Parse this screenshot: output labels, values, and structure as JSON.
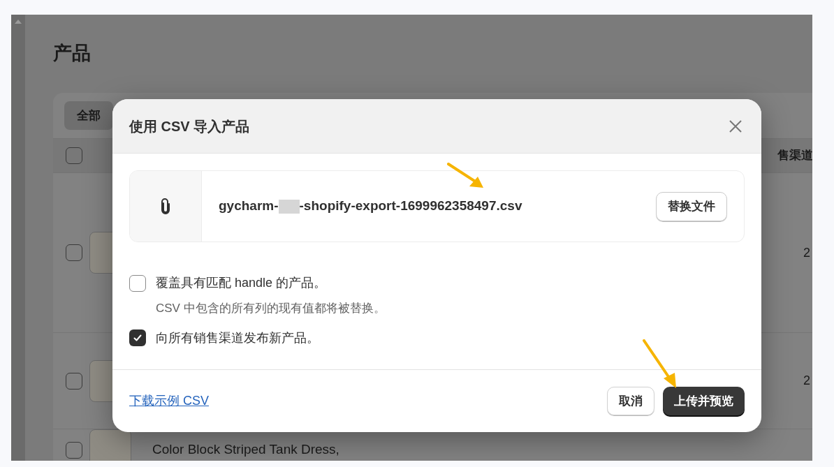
{
  "background_page": {
    "title": "产品",
    "tabs": [
      {
        "label": "全部",
        "selected": true
      }
    ],
    "table": {
      "header": {
        "checked": false,
        "column_label": "售渠道"
      },
      "rows": [
        {
          "checked": false,
          "kind": "thumbnail",
          "value": "2"
        },
        {
          "checked": false,
          "kind": "thumbnail",
          "value": "2"
        },
        {
          "checked": false,
          "kind": "thumbnail",
          "product": "Color Block Striped Tank Dress,"
        }
      ]
    }
  },
  "dialog": {
    "title": "使用 CSV 导入产品",
    "file": {
      "name_start": "gycharm-",
      "name_end": "-shopify-export-1699962358497.csv",
      "replace_button": "替换文件"
    },
    "options": [
      {
        "label": "覆盖具有匹配 handle 的产品。",
        "hint": "CSV 中包含的所有列的现有值都将被替换。",
        "checked": false
      },
      {
        "label": "向所有销售渠道发布新产品。",
        "checked": true
      }
    ],
    "footer": {
      "link": "下载示例 CSV",
      "buttons": [
        {
          "label": "取消",
          "kind": "secondary"
        },
        {
          "label": "上传并预览",
          "kind": "primary"
        }
      ]
    }
  }
}
